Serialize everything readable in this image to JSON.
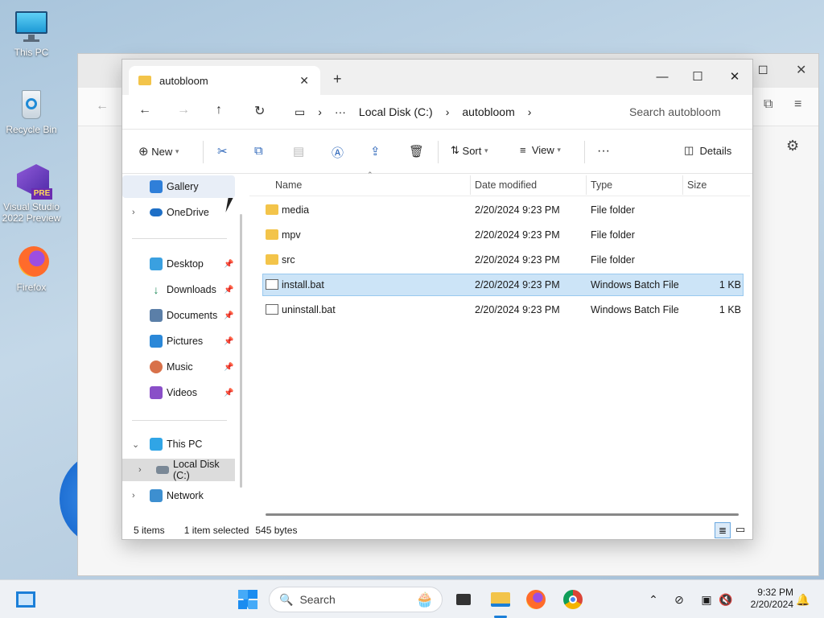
{
  "desktop": {
    "icons": [
      {
        "label": "This PC"
      },
      {
        "label": "Recycle Bin"
      },
      {
        "label": "Visual Studio 2022 Preview",
        "badge": "PRE"
      },
      {
        "label": "Firefox"
      }
    ]
  },
  "window": {
    "tab_title": "autobloom",
    "address": {
      "crumbs": [
        "Local Disk (C:)",
        "autobloom"
      ],
      "search_placeholder": "Search autobloom"
    },
    "toolbar": {
      "new": "New",
      "sort": "Sort",
      "view": "View",
      "details": "Details"
    },
    "sidebar": {
      "items": [
        {
          "label": "Gallery"
        },
        {
          "label": "OneDrive"
        },
        {
          "label": "Desktop"
        },
        {
          "label": "Downloads"
        },
        {
          "label": "Documents"
        },
        {
          "label": "Pictures"
        },
        {
          "label": "Music"
        },
        {
          "label": "Videos"
        },
        {
          "label": "This PC"
        },
        {
          "label": "Local Disk (C:)"
        },
        {
          "label": "Network"
        }
      ]
    },
    "columns": [
      "Name",
      "Date modified",
      "Type",
      "Size"
    ],
    "files": [
      {
        "name": "media",
        "date": "2/20/2024 9:23 PM",
        "type": "File folder",
        "size": ""
      },
      {
        "name": "mpv",
        "date": "2/20/2024 9:23 PM",
        "type": "File folder",
        "size": ""
      },
      {
        "name": "src",
        "date": "2/20/2024 9:23 PM",
        "type": "File folder",
        "size": ""
      },
      {
        "name": "install.bat",
        "date": "2/20/2024 9:23 PM",
        "type": "Windows Batch File",
        "size": "1 KB"
      },
      {
        "name": "uninstall.bat",
        "date": "2/20/2024 9:23 PM",
        "type": "Windows Batch File",
        "size": "1 KB"
      }
    ],
    "status": {
      "count": "5 items",
      "selected": "1 item selected",
      "size": "545 bytes"
    }
  },
  "taskbar": {
    "search": "Search",
    "time": "9:32 PM",
    "date": "2/20/2024"
  }
}
